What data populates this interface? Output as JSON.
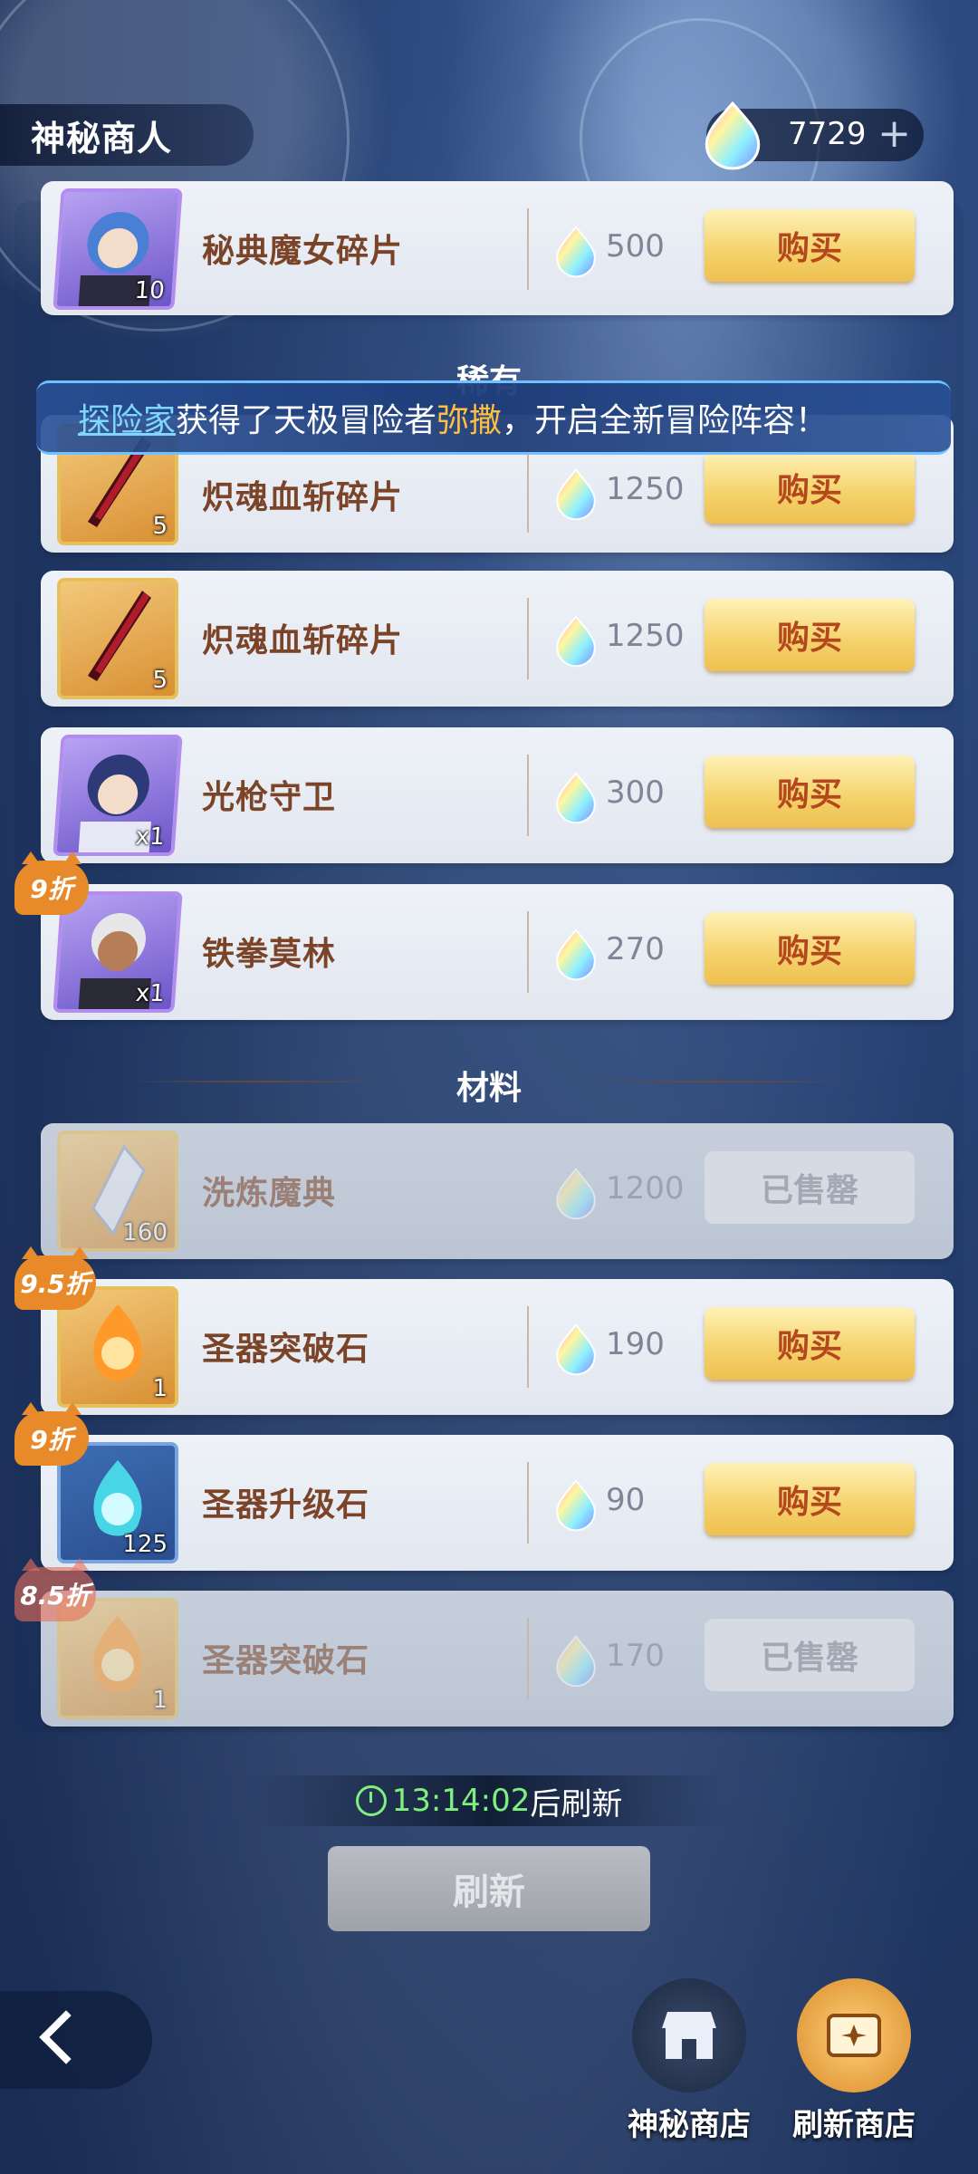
{
  "header": {
    "title": "神秘商人",
    "currency_amount": "7729",
    "plus": "+"
  },
  "banner": {
    "prefix": "探险家",
    "text1": "获得了天极冒险者",
    "hero": "弥撒",
    "text2": "，开启全新冒险阵容！"
  },
  "sections": {
    "rare": "稀有",
    "materials": "材料"
  },
  "items": [
    {
      "name": "秘典魔女碎片",
      "qty": "10",
      "price": "500",
      "button": "购买",
      "discount": ""
    },
    {
      "name": "炽魂血斩碎片",
      "qty": "5",
      "price": "1250",
      "button": "购买",
      "discount": ""
    },
    {
      "name": "炽魂血斩碎片",
      "qty": "5",
      "price": "1250",
      "button": "购买",
      "discount": ""
    },
    {
      "name": "光枪守卫",
      "qty": "x1",
      "price": "300",
      "button": "购买",
      "discount": ""
    },
    {
      "name": "铁拳莫林",
      "qty": "x1",
      "price": "270",
      "button": "购买",
      "discount": "9折"
    },
    {
      "name": "洗炼魔典",
      "qty": "160",
      "price": "1200",
      "button": "已售罄",
      "discount": ""
    },
    {
      "name": "圣器突破石",
      "qty": "1",
      "price": "190",
      "button": "购买",
      "discount": "9.5折"
    },
    {
      "name": "圣器升级石",
      "qty": "125",
      "price": "90",
      "button": "购买",
      "discount": "9折"
    },
    {
      "name": "圣器突破石",
      "qty": "1",
      "price": "170",
      "button": "已售罄",
      "discount": "8.5折"
    }
  ],
  "timer": {
    "time": "13:14:02",
    "suffix": "后刷新"
  },
  "refresh_button": "刷新",
  "nav": {
    "mystery_shop": "神秘商店",
    "refresh_shop": "刷新商店"
  },
  "colors": {
    "buy_button": "#f5d46e",
    "button_text": "#b5471e",
    "item_name": "#7b4428",
    "discount": "#e8892a"
  }
}
